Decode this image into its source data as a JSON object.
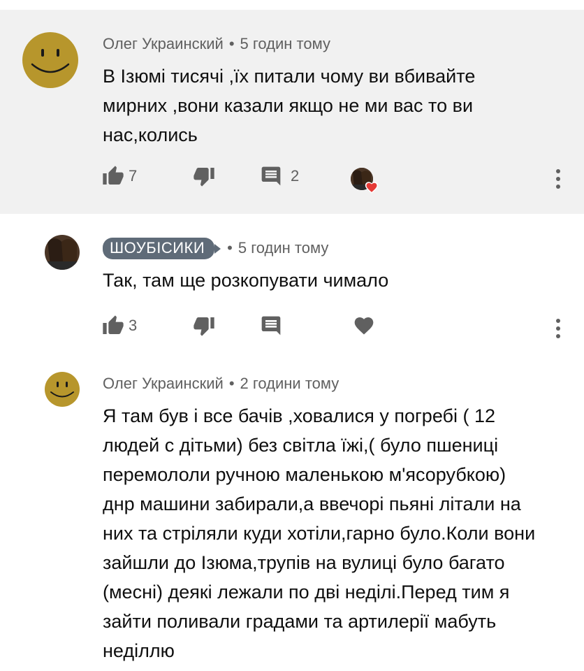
{
  "comments": [
    {
      "author": "Олег Украинский",
      "time": "5 годин тому",
      "text_lines": [
        "В Ізюмі тисячі ,їх питали чому ви вбивайте",
        "мирних ,вони казали якщо не ми вас то ви",
        "нас,колись"
      ],
      "likes": "7",
      "replies": "2",
      "highlighted": true,
      "creator_hearted": true
    },
    {
      "author": "ШОУБІСИКИ",
      "time": "5 годин тому",
      "text_lines": [
        "Так, там ще розкопувати чимало"
      ],
      "likes": "3",
      "is_channel_owner": true
    },
    {
      "author": "Олег Украинский",
      "time": "2 години тому",
      "text_lines": [
        "Я там був і все бачів ,ховалися у погребі ( 12",
        "людей с дітьми) без світла їжі,( було пшениці",
        "перемололи ручною маленькою м'ясорубкою)",
        "днр машини забирали,а ввечорі пьяні літали на",
        "них та стріляли куди хотіли,гарно було.Коли вони",
        "зайшли до Ізюма,трупів на вулиці було багато",
        "(месні) деякі лежали по дві неділі.Перед тим я",
        "зайти поливали градами та артилерії мабуть",
        "неділлю"
      ]
    }
  ],
  "icons": {
    "like": "thumb-up-icon",
    "dislike": "thumb-down-icon",
    "reply": "comment-icon",
    "heart": "heart-icon",
    "more": "more-vert-icon"
  },
  "colors": {
    "highlight_bg": "#f1f1f1",
    "meta_text": "#606060",
    "icon": "#606060",
    "channel_chip": "#5f6b78",
    "heart_red": "#e53935",
    "avatar_yellow": "#b7962c"
  }
}
